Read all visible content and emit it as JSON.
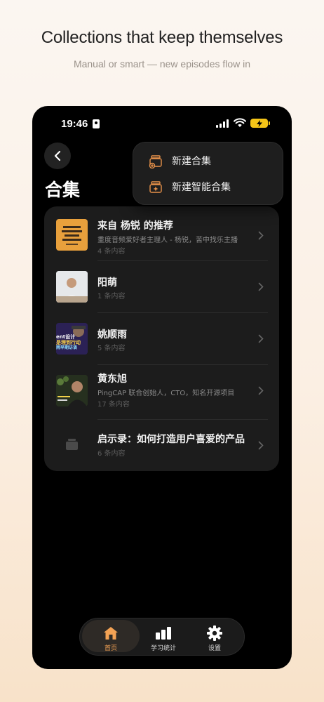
{
  "marketing": {
    "headline": "Collections that keep themselves",
    "subline": "Manual or smart — new episodes flow in"
  },
  "status_bar": {
    "time": "19:46"
  },
  "page": {
    "title": "合集"
  },
  "popup_menu": {
    "items": [
      {
        "label": "新建合集",
        "icon": "new-collection-icon"
      },
      {
        "label": "新建智能合集",
        "icon": "new-smart-collection-icon"
      }
    ]
  },
  "collections": [
    {
      "title": "来自 杨锐 的推荐",
      "desc": "重度音频爱好者主理人 - 杨锐，苦中找乐主播",
      "count": "4 条内容",
      "thumb": "podcast-cover"
    },
    {
      "title": "阳萌",
      "desc": "",
      "count": "1 条内容",
      "thumb": "person-photo"
    },
    {
      "title": "姚顺雨",
      "desc": "",
      "count": "5 条内容",
      "thumb": "video-cover",
      "thumb_text": [
        "ent设计",
        "是理到行动",
        "雨早期访谈"
      ]
    },
    {
      "title": "黄东旭",
      "desc": "PingCAP 联合创始人，CTO，知名开源项目",
      "count": "17 条内容",
      "thumb": "person-outdoor-photo"
    },
    {
      "title": "启示录：如何打造用户喜爱的产品",
      "desc": "",
      "count": "6 条内容",
      "thumb": "folder-icon"
    }
  ],
  "tab_bar": {
    "tabs": [
      {
        "label": "首页",
        "icon": "home-icon",
        "active": true
      },
      {
        "label": "学习统计",
        "icon": "stats-icon",
        "active": false
      },
      {
        "label": "设置",
        "icon": "gear-icon",
        "active": false
      }
    ]
  },
  "colors": {
    "accent": "#f3a254",
    "phone_bg": "#000000",
    "card_bg": "#1c1c1c",
    "battery": "#f5c518"
  }
}
